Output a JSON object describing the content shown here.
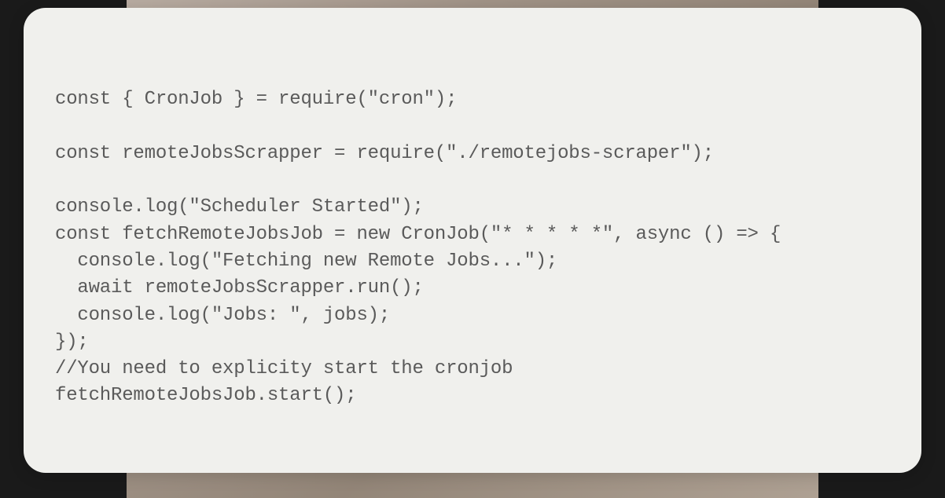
{
  "code": {
    "lines": [
      "const { CronJob } = require(\"cron\");",
      "",
      "const remoteJobsScrapper = require(\"./remotejobs-scraper\");",
      "",
      "console.log(\"Scheduler Started\");",
      "const fetchRemoteJobsJob = new CronJob(\"* * * * *\", async () => {",
      "  console.log(\"Fetching new Remote Jobs...\");",
      "  await remoteJobsScrapper.run();",
      "  console.log(\"Jobs: \", jobs);",
      "});",
      "//You need to explicity start the cronjob",
      "fetchRemoteJobsJob.start();"
    ]
  },
  "colors": {
    "card_bg": "#f0f0ed",
    "text": "#5a5a5a",
    "page_bg": "#1a1a1a"
  }
}
